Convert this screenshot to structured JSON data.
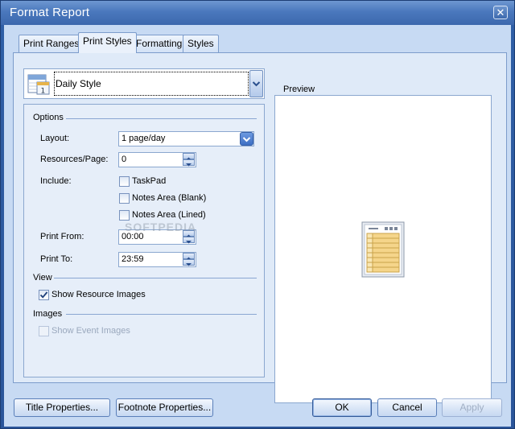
{
  "window": {
    "title": "Format Report",
    "close_glyph": "✕"
  },
  "tabs": [
    {
      "label": "Print Ranges",
      "active": false
    },
    {
      "label": "Print Styles",
      "active": true
    },
    {
      "label": "Formatting",
      "active": false
    },
    {
      "label": "Styles",
      "active": false
    }
  ],
  "style_selector": {
    "value": "Daily Style",
    "icon": "calendar-icon"
  },
  "options": {
    "header": "Options",
    "layout_label": "Layout:",
    "layout_value": "1 page/day",
    "resources_label": "Resources/Page:",
    "resources_value": "0",
    "include_label": "Include:",
    "include_items": [
      {
        "label": "TaskPad",
        "checked": false
      },
      {
        "label": "Notes Area (Blank)",
        "checked": false
      },
      {
        "label": "Notes Area (Lined)",
        "checked": false
      }
    ],
    "print_from_label": "Print From:",
    "print_from_value": "00:00",
    "print_to_label": "Print To:",
    "print_to_value": "23:59"
  },
  "view": {
    "header": "View",
    "show_resource_images_label": "Show Resource Images",
    "show_resource_images_checked": true
  },
  "images": {
    "header": "Images",
    "show_event_images_label": "Show Event Images",
    "show_event_images_enabled": false
  },
  "preview": {
    "label": "Preview",
    "icon": "report-preview-icon"
  },
  "buttons": {
    "title_properties": "Title Properties...",
    "footnote_properties": "Footnote Properties...",
    "ok": "OK",
    "cancel": "Cancel",
    "apply": "Apply"
  },
  "watermark": "SOFTPEDIA"
}
